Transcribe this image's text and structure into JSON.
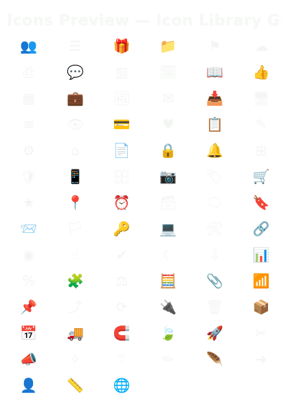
{
  "screen": {
    "title": "Icons Preview — Icon Library Grid"
  },
  "icons": [
    {
      "name": "users-icon",
      "glyph": "👥"
    },
    {
      "name": "layers-icon",
      "glyph": "☰"
    },
    {
      "name": "gift-icon",
      "glyph": "🎁"
    },
    {
      "name": "folder-icon",
      "glyph": "📁"
    },
    {
      "name": "flag-icon",
      "glyph": "⚑"
    },
    {
      "name": "cloud-icon",
      "glyph": "☁"
    },
    {
      "name": "print-icon",
      "glyph": "⎙"
    },
    {
      "name": "chat-icon",
      "glyph": "💬"
    },
    {
      "name": "chart-bar-icon",
      "glyph": "▥"
    },
    {
      "name": "calendar-icon",
      "glyph": "🗓"
    },
    {
      "name": "book-icon",
      "glyph": "📖"
    },
    {
      "name": "thumbs-up-icon",
      "glyph": "👍"
    },
    {
      "name": "table-icon",
      "glyph": "▦"
    },
    {
      "name": "briefcase-icon",
      "glyph": "💼"
    },
    {
      "name": "image-icon",
      "glyph": "🖼"
    },
    {
      "name": "mail-icon",
      "glyph": "✉"
    },
    {
      "name": "inbox-icon",
      "glyph": "📥"
    },
    {
      "name": "monitor-icon",
      "glyph": "🖥"
    },
    {
      "name": "list-icon",
      "glyph": "≡"
    },
    {
      "name": "eye-icon",
      "glyph": "👁"
    },
    {
      "name": "credit-card-icon",
      "glyph": "💳"
    },
    {
      "name": "heart-icon",
      "glyph": "♥"
    },
    {
      "name": "clipboard-icon",
      "glyph": "📋"
    },
    {
      "name": "pen-icon",
      "glyph": "✎"
    },
    {
      "name": "gear-icon",
      "glyph": "⚙"
    },
    {
      "name": "home-icon",
      "glyph": "⌂"
    },
    {
      "name": "document-icon",
      "glyph": "📄"
    },
    {
      "name": "lock-icon",
      "glyph": "🔒"
    },
    {
      "name": "bell-icon",
      "glyph": "🔔"
    },
    {
      "name": "grid-icon",
      "glyph": "⊞"
    },
    {
      "name": "shield-icon",
      "glyph": "🛡"
    },
    {
      "name": "phone-icon",
      "glyph": "📱"
    },
    {
      "name": "database-icon",
      "glyph": "🗄"
    },
    {
      "name": "camera-icon",
      "glyph": "📷"
    },
    {
      "name": "tag-icon",
      "glyph": "🏷"
    },
    {
      "name": "cart-icon",
      "glyph": "🛒"
    },
    {
      "name": "star-icon",
      "glyph": "★"
    },
    {
      "name": "location-icon",
      "glyph": "📍"
    },
    {
      "name": "clock-icon",
      "glyph": "⏰"
    },
    {
      "name": "archive-icon",
      "glyph": "🗃"
    },
    {
      "name": "chat-bubble-icon",
      "glyph": "🗨"
    },
    {
      "name": "bookmark-icon",
      "glyph": "🔖"
    },
    {
      "name": "envelope-open-icon",
      "glyph": "📨"
    },
    {
      "name": "bookmark-outline-icon",
      "glyph": "🏳"
    },
    {
      "name": "key-icon",
      "glyph": "🔑"
    },
    {
      "name": "laptop-icon",
      "glyph": "💻"
    },
    {
      "name": "tools-icon",
      "glyph": "🛠"
    },
    {
      "name": "link-icon",
      "glyph": "🔗"
    },
    {
      "name": "user-circle-icon",
      "glyph": "◉"
    },
    {
      "name": "thumb-icon",
      "glyph": "☝"
    },
    {
      "name": "check-icon",
      "glyph": "✔"
    },
    {
      "name": "moon-icon",
      "glyph": "☾"
    },
    {
      "name": "download-icon",
      "glyph": "⇩"
    },
    {
      "name": "bar-chart-icon",
      "glyph": "📊"
    },
    {
      "name": "percent-icon",
      "glyph": "%"
    },
    {
      "name": "puzzle-icon",
      "glyph": "🧩"
    },
    {
      "name": "scale-icon",
      "glyph": "⚖"
    },
    {
      "name": "calculator-icon",
      "glyph": "🧮"
    },
    {
      "name": "paperclip-icon",
      "glyph": "📎"
    },
    {
      "name": "signal-icon",
      "glyph": "📶"
    },
    {
      "name": "pin-icon",
      "glyph": "📌"
    },
    {
      "name": "share-icon",
      "glyph": "⤴"
    },
    {
      "name": "refresh-icon",
      "glyph": "⟳"
    },
    {
      "name": "plug-icon",
      "glyph": "🔌"
    },
    {
      "name": "trash-icon",
      "glyph": "🗑"
    },
    {
      "name": "box-icon",
      "glyph": "📦"
    },
    {
      "name": "calendar-grid-icon",
      "glyph": "📅"
    },
    {
      "name": "truck-icon",
      "glyph": "🚚"
    },
    {
      "name": "magnet-icon",
      "glyph": "🧲"
    },
    {
      "name": "leaf-icon",
      "glyph": "🍃"
    },
    {
      "name": "rocket-icon",
      "glyph": "🚀"
    },
    {
      "name": "scissors-icon",
      "glyph": "✂"
    },
    {
      "name": "megaphone-icon",
      "glyph": "📣"
    },
    {
      "name": "spark-icon",
      "glyph": "✧"
    },
    {
      "name": "wand-icon",
      "glyph": "⚚"
    },
    {
      "name": "pencil-icon",
      "glyph": "✏"
    },
    {
      "name": "feather-icon",
      "glyph": "🪶"
    },
    {
      "name": "arrow-right-icon",
      "glyph": "➜"
    },
    {
      "name": "person-icon",
      "glyph": "👤"
    },
    {
      "name": "ruler-icon",
      "glyph": "📏"
    },
    {
      "name": "globe-icon",
      "glyph": "🌐"
    }
  ]
}
